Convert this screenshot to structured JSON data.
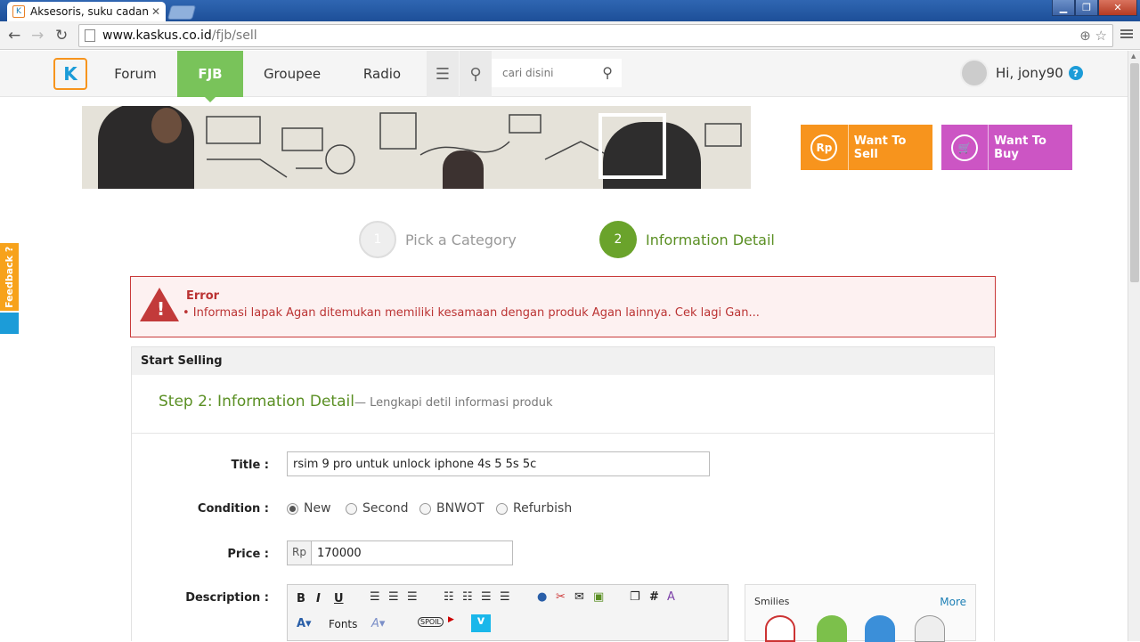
{
  "browser": {
    "tab_title": "Aksesoris, suku cadang HP",
    "tab_close": "✕",
    "url_domain": "www.kaskus.co.id",
    "url_path": "/fjb/sell",
    "back": "←",
    "forward": "→",
    "reload": "↻",
    "zoom_icon": "⊕",
    "star_icon": "☆",
    "min": "▁",
    "max": "❐",
    "close": "✕"
  },
  "header": {
    "logo": "K",
    "nav": [
      "Forum",
      "FJB",
      "Groupee",
      "Radio"
    ],
    "search_placeholder": "cari disini",
    "search_icon": "⚲",
    "menu_icon": "☰",
    "location_icon": "⚲",
    "greeting": "Hi, jony90",
    "help": "?"
  },
  "cta": {
    "sell_icon": "Rp",
    "sell_label": "Want To Sell",
    "buy_icon": "🛒",
    "buy_label": "Want To Buy"
  },
  "steps": [
    {
      "num": "1",
      "label": "Pick a Category"
    },
    {
      "num": "2",
      "label": "Information Detail"
    }
  ],
  "error": {
    "title": "Error",
    "message": "•   Informasi lapak Agan ditemukan memiliki kesamaan dengan produk Agan lainnya. Cek lagi Gan..."
  },
  "form": {
    "panel_title": "Start Selling",
    "step_title": "Step 2: Information Detail",
    "step_sub": "— Lengkapi detil informasi produk",
    "title_label": "Title  :",
    "title_value": "rsim 9 pro untuk unlock iphone 4s 5 5s 5c",
    "condition_label": "Condition  :",
    "conditions": [
      "New",
      "Second",
      "BNWOT",
      "Refurbish"
    ],
    "price_label": "Price  :",
    "currency": "Rp",
    "price_value": "170000",
    "description_label": "Description  :",
    "fonts_label": "Fonts"
  },
  "smilies": {
    "title": "Smilies",
    "more": "More"
  },
  "feedback": "Feedback ?"
}
